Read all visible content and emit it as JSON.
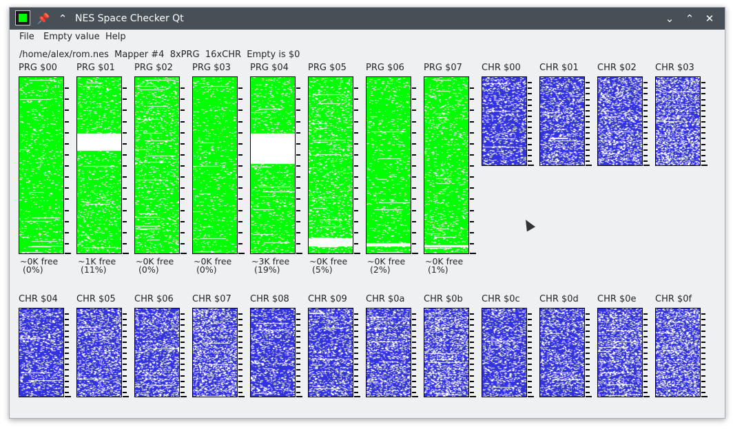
{
  "window": {
    "title": "NES Space Checker Qt",
    "pin_icon": "pin-icon",
    "keep_above_icon": "keep-above-icon",
    "minimize_icon": "chevron-down-icon",
    "maximize_icon": "chevron-up-icon",
    "close_icon": "close-icon",
    "pin_glyph": "📌",
    "keep_above_glyph": "⌃",
    "minimize_glyph": "⌄",
    "maximize_glyph": "⌃",
    "close_glyph": "✕"
  },
  "menu": {
    "file": "File",
    "empty_value": "Empty value",
    "help": "Help"
  },
  "info": {
    "path": "/home/alex/rom.nes",
    "mapper": "Mapper #4",
    "prg": "8xPRG",
    "chr": "16xCHR",
    "empty": "Empty is $0"
  },
  "colors": {
    "prg": "#00ff00",
    "chr": "#3333dd",
    "empty": "#ffffff"
  },
  "prg_banks": [
    {
      "label": "PRG $00",
      "free_size": "~0K free",
      "free_pct": "(0%)",
      "empty_fraction": 0.0
    },
    {
      "label": "PRG $01",
      "free_size": "~1K free",
      "free_pct": "(11%)",
      "empty_fraction": 0.11
    },
    {
      "label": "PRG $02",
      "free_size": "~0K free",
      "free_pct": "(0%)",
      "empty_fraction": 0.0
    },
    {
      "label": "PRG $03",
      "free_size": "~0K free",
      "free_pct": "(0%)",
      "empty_fraction": 0.0
    },
    {
      "label": "PRG $04",
      "free_size": "~3K free",
      "free_pct": "(19%)",
      "empty_fraction": 0.19
    },
    {
      "label": "PRG $05",
      "free_size": "~0K free",
      "free_pct": "(5%)",
      "empty_fraction": 0.05
    },
    {
      "label": "PRG $06",
      "free_size": "~0K free",
      "free_pct": "(2%)",
      "empty_fraction": 0.02
    },
    {
      "label": "PRG $07",
      "free_size": "~0K free",
      "free_pct": "(1%)",
      "empty_fraction": 0.01
    }
  ],
  "chr_banks": [
    {
      "label": "CHR $00"
    },
    {
      "label": "CHR $01"
    },
    {
      "label": "CHR $02"
    },
    {
      "label": "CHR $03"
    },
    {
      "label": "CHR $04"
    },
    {
      "label": "CHR $05"
    },
    {
      "label": "CHR $06"
    },
    {
      "label": "CHR $07"
    },
    {
      "label": "CHR $08"
    },
    {
      "label": "CHR $09"
    },
    {
      "label": "CHR $0a"
    },
    {
      "label": "CHR $0b"
    },
    {
      "label": "CHR $0c"
    },
    {
      "label": "CHR $0d"
    },
    {
      "label": "CHR $0e"
    },
    {
      "label": "CHR $0f"
    }
  ]
}
